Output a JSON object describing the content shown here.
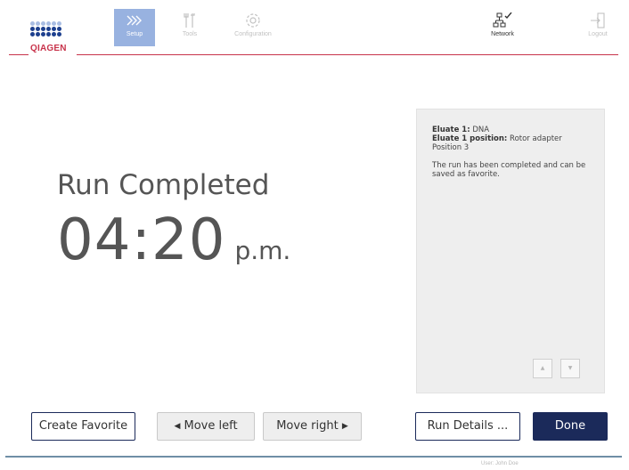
{
  "brand": {
    "logo_text": "QIAGEN",
    "accent_color": "#c8334b",
    "logo_dark": "#1d3f8e",
    "logo_light": "#a9bde3"
  },
  "nav": {
    "tabs": [
      {
        "label": "Setup",
        "icon": "chevrons-right-icon",
        "active": true
      },
      {
        "label": "Tools",
        "icon": "tools-icon",
        "active": false
      },
      {
        "label": "Configuration",
        "icon": "gear-icon",
        "active": false
      }
    ],
    "network": {
      "label": "Network",
      "icon": "network-connected-icon"
    },
    "logout": {
      "label": "Logout",
      "icon": "logout-icon"
    }
  },
  "run": {
    "status": "Run Completed",
    "time": "04:20",
    "ampm": "p.m."
  },
  "info_panel": {
    "eluate_label": "Eluate 1:",
    "eluate_value": "DNA",
    "position_label": "Eluate 1 position:",
    "position_value": "Rotor adapter Position 3",
    "message": "The run has been completed and can be saved as favorite.",
    "scroll_up_icon": "▲",
    "scroll_down_icon": "▼"
  },
  "buttons": {
    "create_favorite": "Create Favorite",
    "move_left": "Move left",
    "move_right": "Move right",
    "run_details": "Run Details ...",
    "done": "Done",
    "primary_color": "#1b2a5a"
  },
  "footer": {
    "user": "User: John Doe"
  }
}
